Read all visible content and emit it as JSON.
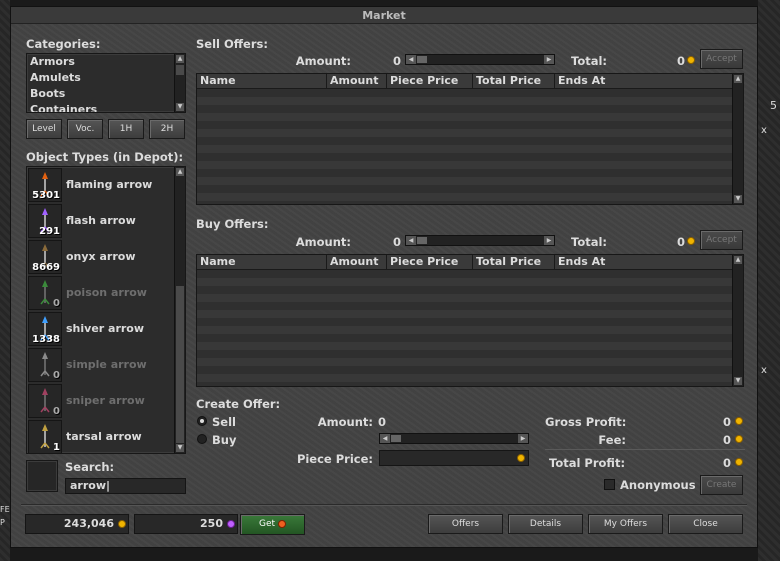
{
  "window": {
    "title": "Market"
  },
  "categories": {
    "label": "Categories:",
    "items": [
      "Armors",
      "Amulets",
      "Boots",
      "Containers"
    ],
    "filters": [
      "Level",
      "Voc.",
      "1H",
      "2H"
    ]
  },
  "object_types": {
    "label": "Object Types (in Depot):",
    "items": [
      {
        "name": "flaming arrow",
        "count": "5301",
        "color": "#e06010",
        "dim": false
      },
      {
        "name": "flash arrow",
        "count": "291",
        "color": "#a060ff",
        "dim": false
      },
      {
        "name": "onyx arrow",
        "count": "8669",
        "color": "#8a6a3a",
        "dim": false
      },
      {
        "name": "poison arrow",
        "count": "0",
        "color": "#3a8a3a",
        "dim": true
      },
      {
        "name": "shiver arrow",
        "count": "1338",
        "color": "#40a0ff",
        "dim": false
      },
      {
        "name": "simple arrow",
        "count": "0",
        "color": "#8a8a8a",
        "dim": true
      },
      {
        "name": "sniper arrow",
        "count": "0",
        "color": "#a04060",
        "dim": true
      },
      {
        "name": "tarsal arrow",
        "count": "1",
        "color": "#c0a040",
        "dim": false
      }
    ]
  },
  "search": {
    "label": "Search:",
    "value": "arrow"
  },
  "sell": {
    "label": "Sell Offers:",
    "amount_label": "Amount:",
    "amount": "0",
    "total_label": "Total:",
    "total": "0",
    "accept": "Accept"
  },
  "buy": {
    "label": "Buy Offers:",
    "amount_label": "Amount:",
    "amount": "0",
    "total_label": "Total:",
    "total": "0",
    "accept": "Accept"
  },
  "columns": [
    "Name",
    "Amount",
    "Piece Price",
    "Total Price",
    "Ends At"
  ],
  "create": {
    "label": "Create Offer:",
    "sell": "Sell",
    "buy": "Buy",
    "amount_label": "Amount:",
    "amount": "0",
    "piece_price_label": "Piece Price:",
    "gross_label": "Gross Profit:",
    "gross": "0",
    "fee_label": "Fee:",
    "fee": "0",
    "total_label": "Total Profit:",
    "total": "0",
    "anonymous": "Anonymous",
    "create_btn": "Create"
  },
  "footer": {
    "gold": "243,046",
    "coins": "250",
    "get": "Get",
    "offers": "Offers",
    "details": "Details",
    "my_offers": "My Offers",
    "close": "Close"
  },
  "background": {
    "num_top": "5",
    "num_close": "5",
    "x1": "x",
    "x2": "x",
    "fe": "FE",
    "p": "P"
  }
}
